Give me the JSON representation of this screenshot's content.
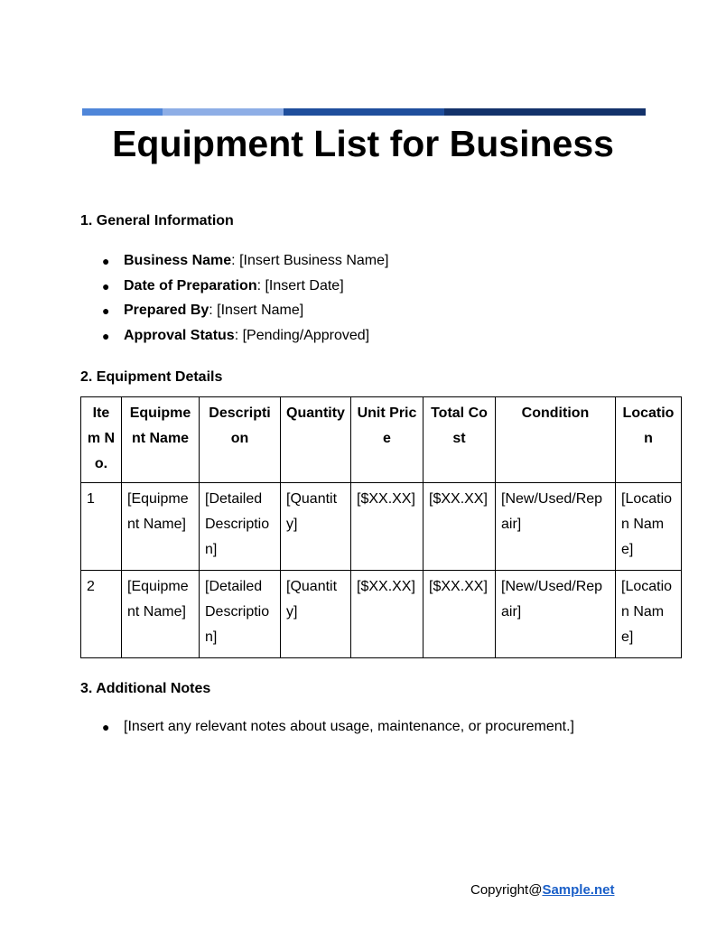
{
  "header": {
    "band_colors": [
      "#4f86d9",
      "#8eaee6",
      "#1f4e9c",
      "#13326a"
    ],
    "title": "Equipment List for Business"
  },
  "sections": {
    "general": {
      "heading": "1. General Information",
      "items": [
        {
          "label": "Business Name",
          "value": ": [Insert Business Name]"
        },
        {
          "label": "Date of Preparation",
          "value": ": [Insert Date]"
        },
        {
          "label": "Prepared By",
          "value": ": [Insert Name]"
        },
        {
          "label": "Approval Status",
          "value": ": [Pending/Approved]"
        }
      ]
    },
    "details": {
      "heading": "2. Equipment Details",
      "columns": [
        "Item No.",
        "Equipment Name",
        "Description",
        "Quantity",
        "Unit Price",
        "Total Cost",
        "Condition",
        "Location"
      ],
      "rows": [
        [
          "1",
          "[Equipment Name]",
          "[Detailed Description]",
          "[Quantity]",
          "[$XX.XX]",
          "[$XX.XX]",
          "[New/Used/Repair]",
          "[Location Name]"
        ],
        [
          "2",
          "[Equipment Name]",
          "[Detailed Description]",
          "[Quantity]",
          "[$XX.XX]",
          "[$XX.XX]",
          "[New/Used/Repair]",
          "[Location Name]"
        ]
      ]
    },
    "notes": {
      "heading": "3. Additional Notes",
      "items": [
        "[Insert any relevant notes about usage, maintenance, or procurement.]"
      ]
    }
  },
  "footer": {
    "prefix": "Copyright@",
    "link": "Sample.net",
    "link_color": "#1a5fc8"
  },
  "bullet_glyph": "●"
}
